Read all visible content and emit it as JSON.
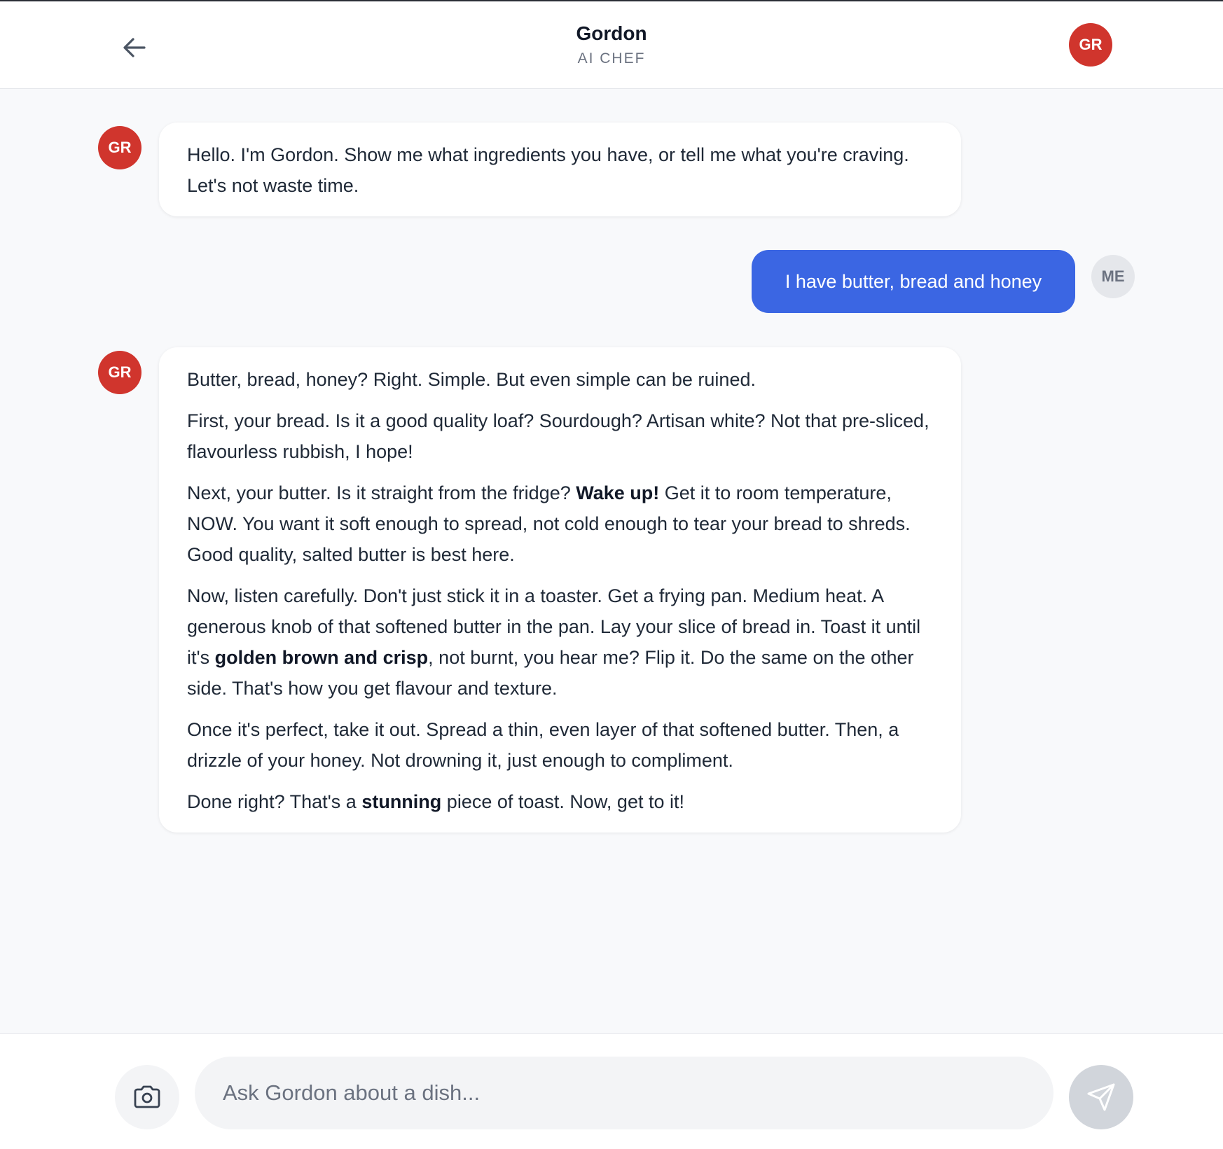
{
  "header": {
    "title": "Gordon",
    "subtitle": "AI CHEF",
    "avatar_initials": "GR"
  },
  "messages": [
    {
      "sender": "bot",
      "avatar": "GR",
      "paragraphs": [
        [
          {
            "text": "Hello. I'm Gordon. Show me what ingredients you have, or tell me what you're craving. Let's not waste time."
          }
        ]
      ]
    },
    {
      "sender": "user",
      "avatar": "ME",
      "text": "I have butter, bread and honey"
    },
    {
      "sender": "bot",
      "avatar": "GR",
      "paragraphs": [
        [
          {
            "text": "Butter, bread, honey? Right. Simple. But even simple can be ruined."
          }
        ],
        [
          {
            "text": "First, your bread. Is it a good quality loaf? Sourdough? Artisan white? Not that pre-sliced, flavourless rubbish, I hope!"
          }
        ],
        [
          {
            "text": "Next, your butter. Is it straight from the fridge? "
          },
          {
            "text": "Wake up!",
            "bold": true
          },
          {
            "text": " Get it to room temperature, NOW. You want it soft enough to spread, not cold enough to tear your bread to shreds. Good quality, salted butter is best here."
          }
        ],
        [
          {
            "text": "Now, listen carefully. Don't just stick it in a toaster. Get a frying pan. Medium heat. A generous knob of that softened butter in the pan. Lay your slice of bread in. Toast it until it's "
          },
          {
            "text": "golden brown and crisp",
            "bold": true
          },
          {
            "text": ", not burnt, you hear me? Flip it. Do the same on the other side. That's how you get flavour and texture."
          }
        ],
        [
          {
            "text": "Once it's perfect, take it out. Spread a thin, even layer of that softened butter. Then, a drizzle of your honey. Not drowning it, just enough to compliment."
          }
        ],
        [
          {
            "text": "Done right? That's a "
          },
          {
            "text": "stunning",
            "bold": true
          },
          {
            "text": " piece of toast. Now, get to it!"
          }
        ]
      ]
    }
  ],
  "composer": {
    "placeholder": "Ask Gordon about a dish...",
    "value": ""
  },
  "icons": {
    "back": "arrow-left-icon",
    "camera": "camera-icon",
    "send": "send-icon"
  },
  "colors": {
    "brand_red": "#d0352d",
    "user_bubble": "#3b66e3",
    "background": "#f8f9fb"
  }
}
